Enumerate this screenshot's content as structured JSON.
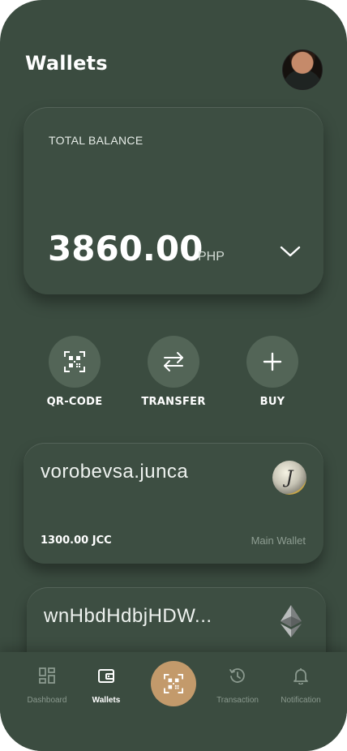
{
  "header": {
    "title": "Wallets"
  },
  "balance": {
    "label": "TOTAL BALANCE",
    "amount": "3860.00",
    "currency": "PHP"
  },
  "actions": [
    {
      "label": "QR-CODE",
      "icon": "qr-code-icon"
    },
    {
      "label": "TRANSFER",
      "icon": "transfer-arrows-icon"
    },
    {
      "label": "BUY",
      "icon": "plus-icon"
    }
  ],
  "wallets": [
    {
      "name": "vorobevsa.junca",
      "balance": "1300.00 JCC",
      "type": "Main Wallet",
      "icon": "jcc-coin-icon",
      "coin_symbol": "J"
    },
    {
      "name": "wnHbdHdbjHDW...",
      "icon": "ethereum-icon"
    }
  ],
  "nav": {
    "items": [
      {
        "label": "Dashboard",
        "icon": "dashboard-grid-icon"
      },
      {
        "label": "Wallets",
        "icon": "wallet-icon",
        "active": true
      },
      {
        "label": "Transaction",
        "icon": "history-icon"
      },
      {
        "label": "Notification",
        "icon": "bell-icon"
      }
    ],
    "center_icon": "qr-scan-icon"
  },
  "colors": {
    "background": "#3b4c40",
    "card": "#3d4e42",
    "action_circle": "#536557",
    "accent": "#c39a6b",
    "muted_text": "#8a998e"
  }
}
